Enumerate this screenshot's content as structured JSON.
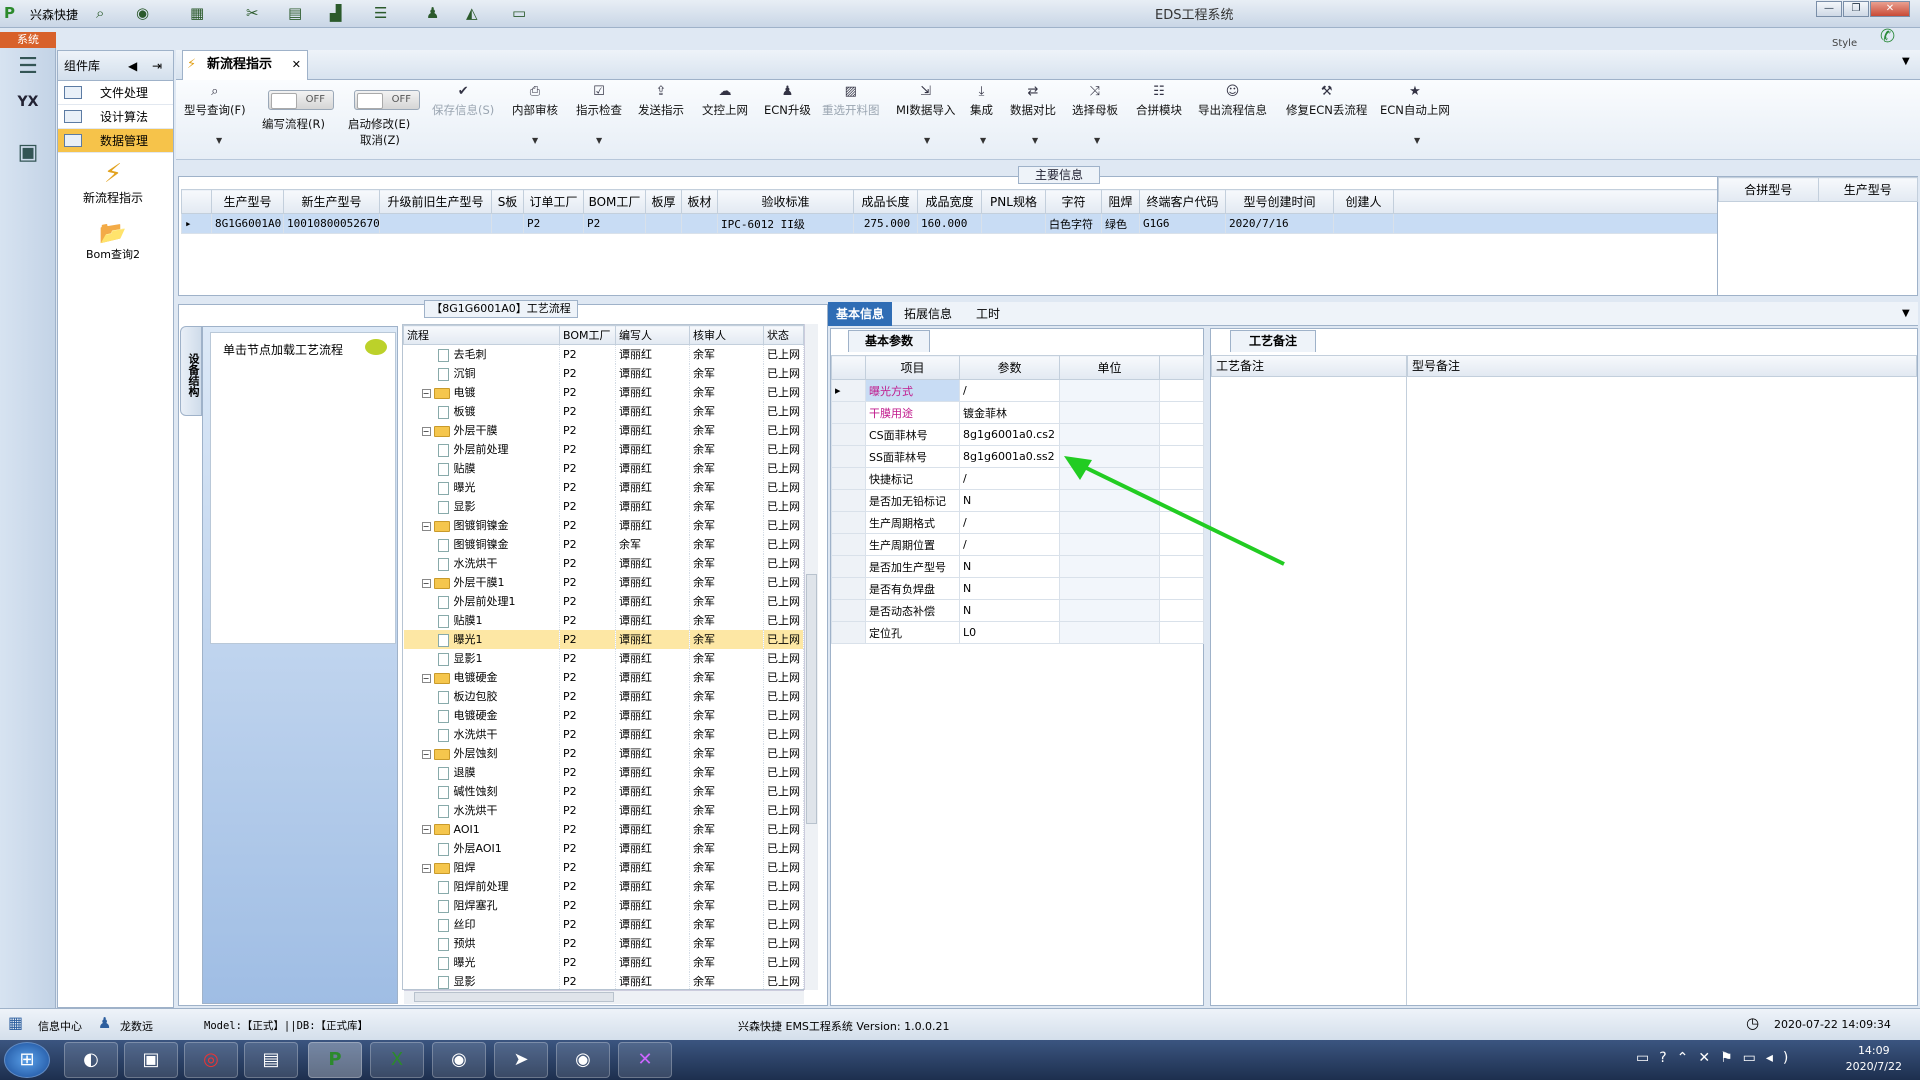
{
  "window": {
    "app_label": "兴森快捷",
    "title": "EDS工程系统",
    "style_label": "Style",
    "sys_tag": "系统"
  },
  "sidebar": {
    "header": "组件库",
    "items": [
      {
        "label": "文件处理"
      },
      {
        "label": "设计算法"
      },
      {
        "label": "数据管理"
      }
    ],
    "shortcuts": [
      {
        "label": "新流程指示"
      },
      {
        "label": "Bom查询2"
      }
    ]
  },
  "tab": {
    "label": "新流程指示"
  },
  "toolbar": {
    "buttons": [
      {
        "label": "型号查询(F)",
        "icon": "search-icon"
      },
      {
        "label": "编写流程(R)",
        "toggle": "OFF"
      },
      {
        "label": "启动修改(E)",
        "toggle": "OFF",
        "sub": "取消(Z)"
      },
      {
        "label": "保存信息(S)",
        "icon": "check-icon"
      },
      {
        "label": "内部审核",
        "icon": "printer-icon"
      },
      {
        "label": "指示检查",
        "icon": "check-icon"
      },
      {
        "label": "发送指示",
        "icon": "upload-icon"
      },
      {
        "label": "文控上网",
        "icon": "cloud-icon"
      },
      {
        "label": "ECN升级",
        "icon": "user-icon"
      },
      {
        "label": "重选开料图",
        "icon": "image-icon"
      },
      {
        "label": "MI数据导入",
        "icon": "import-icon"
      },
      {
        "label": "集成",
        "icon": "download-icon"
      },
      {
        "label": "数据对比",
        "icon": "compare-icon"
      },
      {
        "label": "选择母板",
        "icon": "shuffle-icon"
      },
      {
        "label": "合拼模块",
        "icon": "list-icon"
      },
      {
        "label": "导出流程信息",
        "icon": "smile-icon"
      },
      {
        "label": "修复ECN丢流程",
        "icon": "wrench-icon"
      },
      {
        "label": "ECN自动上网",
        "icon": "star-icon"
      }
    ]
  },
  "main_info": {
    "title": "主要信息",
    "columns": [
      "生产型号",
      "新生产型号",
      "升级前旧生产型号",
      "S板",
      "订单工厂",
      "BOM工厂",
      "板厚",
      "板材",
      "验收标准",
      "成品长度",
      "成品宽度",
      "PNL规格",
      "字符",
      "阻焊",
      "终端客户代码",
      "型号创建时间",
      "创建人"
    ],
    "row": [
      "8G1G6001A0",
      "10010800052670",
      "",
      "",
      "P2",
      "P2",
      "",
      "",
      "IPC-6012 II级",
      "275.000",
      "160.000",
      "",
      "白色字符",
      "绿色",
      "G1G6",
      "2020/7/16",
      ""
    ],
    "side_columns": [
      "合拼型号",
      "生产型号"
    ]
  },
  "flow": {
    "title": "【8G1G6001A0】工艺流程",
    "vtab": "设备结构",
    "hint": "单击节点加载工艺流程",
    "columns": [
      "流程",
      "BOM工厂",
      "编写人",
      "核审人",
      "状态"
    ],
    "rows": [
      {
        "name": "去毛刺",
        "level": 2,
        "factory": "P2",
        "writer": "谭丽红",
        "auditor": "余军",
        "status": "已上网"
      },
      {
        "name": "沉铜",
        "level": 2,
        "factory": "P2",
        "writer": "谭丽红",
        "auditor": "余军",
        "status": "已上网"
      },
      {
        "name": "电镀",
        "level": 1,
        "factory": "P2",
        "writer": "谭丽红",
        "auditor": "余军",
        "status": "已上网"
      },
      {
        "name": "板镀",
        "level": 2,
        "factory": "P2",
        "writer": "谭丽红",
        "auditor": "余军",
        "status": "已上网"
      },
      {
        "name": "外层干膜",
        "level": 1,
        "factory": "P2",
        "writer": "谭丽红",
        "auditor": "余军",
        "status": "已上网"
      },
      {
        "name": "外层前处理",
        "level": 2,
        "factory": "P2",
        "writer": "谭丽红",
        "auditor": "余军",
        "status": "已上网"
      },
      {
        "name": "贴膜",
        "level": 2,
        "factory": "P2",
        "writer": "谭丽红",
        "auditor": "余军",
        "status": "已上网"
      },
      {
        "name": "曝光",
        "level": 2,
        "factory": "P2",
        "writer": "谭丽红",
        "auditor": "余军",
        "status": "已上网"
      },
      {
        "name": "显影",
        "level": 2,
        "factory": "P2",
        "writer": "谭丽红",
        "auditor": "余军",
        "status": "已上网"
      },
      {
        "name": "图镀铜镍金",
        "level": 1,
        "factory": "P2",
        "writer": "谭丽红",
        "auditor": "余军",
        "status": "已上网"
      },
      {
        "name": "图镀铜镍金",
        "level": 2,
        "factory": "P2",
        "writer": "余军",
        "auditor": "余军",
        "status": "已上网"
      },
      {
        "name": "水洗烘干",
        "level": 2,
        "factory": "P2",
        "writer": "谭丽红",
        "auditor": "余军",
        "status": "已上网"
      },
      {
        "name": "外层干膜1",
        "level": 1,
        "factory": "P2",
        "writer": "谭丽红",
        "auditor": "余军",
        "status": "已上网"
      },
      {
        "name": "外层前处理1",
        "level": 2,
        "factory": "P2",
        "writer": "谭丽红",
        "auditor": "余军",
        "status": "已上网"
      },
      {
        "name": "贴膜1",
        "level": 2,
        "factory": "P2",
        "writer": "谭丽红",
        "auditor": "余军",
        "status": "已上网"
      },
      {
        "name": "曝光1",
        "level": 2,
        "factory": "P2",
        "writer": "谭丽红",
        "auditor": "余军",
        "status": "已上网",
        "highlight": true
      },
      {
        "name": "显影1",
        "level": 2,
        "factory": "P2",
        "writer": "谭丽红",
        "auditor": "余军",
        "status": "已上网"
      },
      {
        "name": "电镀硬金",
        "level": 1,
        "factory": "P2",
        "writer": "谭丽红",
        "auditor": "余军",
        "status": "已上网"
      },
      {
        "name": "板边包胶",
        "level": 2,
        "factory": "P2",
        "writer": "谭丽红",
        "auditor": "余军",
        "status": "已上网"
      },
      {
        "name": "电镀硬金",
        "level": 2,
        "factory": "P2",
        "writer": "谭丽红",
        "auditor": "余军",
        "status": "已上网"
      },
      {
        "name": "水洗烘干",
        "level": 2,
        "factory": "P2",
        "writer": "谭丽红",
        "auditor": "余军",
        "status": "已上网"
      },
      {
        "name": "外层蚀刻",
        "level": 1,
        "factory": "P2",
        "writer": "谭丽红",
        "auditor": "余军",
        "status": "已上网"
      },
      {
        "name": "退膜",
        "level": 2,
        "factory": "P2",
        "writer": "谭丽红",
        "auditor": "余军",
        "status": "已上网"
      },
      {
        "name": "碱性蚀刻",
        "level": 2,
        "factory": "P2",
        "writer": "谭丽红",
        "auditor": "余军",
        "status": "已上网"
      },
      {
        "name": "水洗烘干",
        "level": 2,
        "factory": "P2",
        "writer": "谭丽红",
        "auditor": "余军",
        "status": "已上网"
      },
      {
        "name": "AOI1",
        "level": 1,
        "factory": "P2",
        "writer": "谭丽红",
        "auditor": "余军",
        "status": "已上网"
      },
      {
        "name": "外层AOI1",
        "level": 2,
        "factory": "P2",
        "writer": "谭丽红",
        "auditor": "余军",
        "status": "已上网"
      },
      {
        "name": "阻焊",
        "level": 1,
        "factory": "P2",
        "writer": "谭丽红",
        "auditor": "余军",
        "status": "已上网"
      },
      {
        "name": "阻焊前处理",
        "level": 2,
        "factory": "P2",
        "writer": "谭丽红",
        "auditor": "余军",
        "status": "已上网"
      },
      {
        "name": "阻焊塞孔",
        "level": 2,
        "factory": "P2",
        "writer": "谭丽红",
        "auditor": "余军",
        "status": "已上网"
      },
      {
        "name": "丝印",
        "level": 2,
        "factory": "P2",
        "writer": "谭丽红",
        "auditor": "余军",
        "status": "已上网"
      },
      {
        "name": "预烘",
        "level": 2,
        "factory": "P2",
        "writer": "谭丽红",
        "auditor": "余军",
        "status": "已上网"
      },
      {
        "name": "曝光",
        "level": 2,
        "factory": "P2",
        "writer": "谭丽红",
        "auditor": "余军",
        "status": "已上网"
      },
      {
        "name": "显影",
        "level": 2,
        "factory": "P2",
        "writer": "谭丽红",
        "auditor": "余军",
        "status": "已上网"
      }
    ]
  },
  "detail_tabs": [
    "基本信息",
    "拓展信息",
    "工时"
  ],
  "basic_params": {
    "tab": "基本参数",
    "columns": [
      "项目",
      "参数",
      "单位"
    ],
    "rows": [
      {
        "item": "曝光方式",
        "value": "/",
        "pink": true,
        "selected": true
      },
      {
        "item": "干膜用途",
        "value": "镀金菲林",
        "pink": true
      },
      {
        "item": "CS面菲林号",
        "value": "8g1g6001a0.cs2"
      },
      {
        "item": "SS面菲林号",
        "value": "8g1g6001a0.ss2"
      },
      {
        "item": "快捷标记",
        "value": "/"
      },
      {
        "item": "是否加无铅标记",
        "value": "N"
      },
      {
        "item": "生产周期格式",
        "value": "/"
      },
      {
        "item": "生产周期位置",
        "value": "/"
      },
      {
        "item": "是否加生产型号",
        "value": "N"
      },
      {
        "item": "是否有负焊盘",
        "value": "N"
      },
      {
        "item": "是否动态补偿",
        "value": "N"
      },
      {
        "item": "定位孔",
        "value": "L0"
      }
    ]
  },
  "remarks": {
    "tab": "工艺备注",
    "col1": "工艺备注",
    "col2": "型号备注"
  },
  "status": {
    "info_center": "信息中心",
    "user": "龙数远",
    "model": "Model:【正式】||DB:【正式库】",
    "version": "兴森快捷 EMS工程系统 Version: 1.0.0.21",
    "datetime": "2020-07-22 14:09:34"
  },
  "taskbar": {
    "time": "14:09",
    "date": "2020/7/22"
  },
  "colors": {
    "accent": "#2f6db5",
    "highlight": "#f6c34a",
    "arrow": "#22cc22",
    "pink": "#c0198c"
  }
}
